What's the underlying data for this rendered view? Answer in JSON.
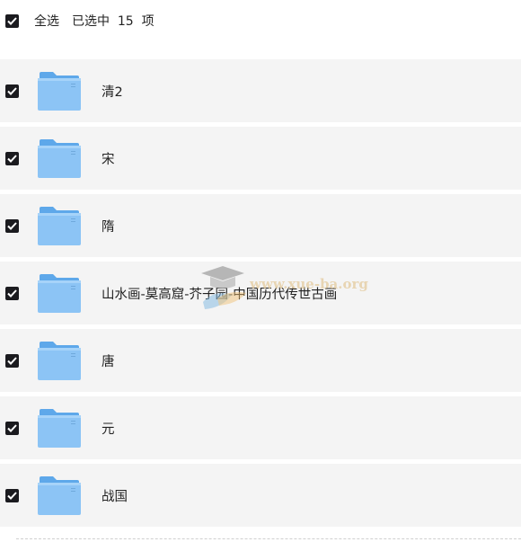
{
  "header": {
    "select_all_label": "全选",
    "selected_text": "已选中  15  项"
  },
  "folders": [
    {
      "name": "清2",
      "checked": true
    },
    {
      "name": "宋",
      "checked": true
    },
    {
      "name": "隋",
      "checked": true
    },
    {
      "name": "山水画-莫高窟-芥子园-中国历代传世古画",
      "checked": true
    },
    {
      "name": "唐",
      "checked": true
    },
    {
      "name": "元",
      "checked": true
    },
    {
      "name": "战国",
      "checked": true
    }
  ],
  "watermark": {
    "text": "www.xue-ba.org"
  },
  "colors": {
    "row_bg": "#f4f4f4",
    "checkbox": "#1b1b1f",
    "folder_front": "#8cc4f5",
    "folder_back": "#5ea8ea"
  }
}
